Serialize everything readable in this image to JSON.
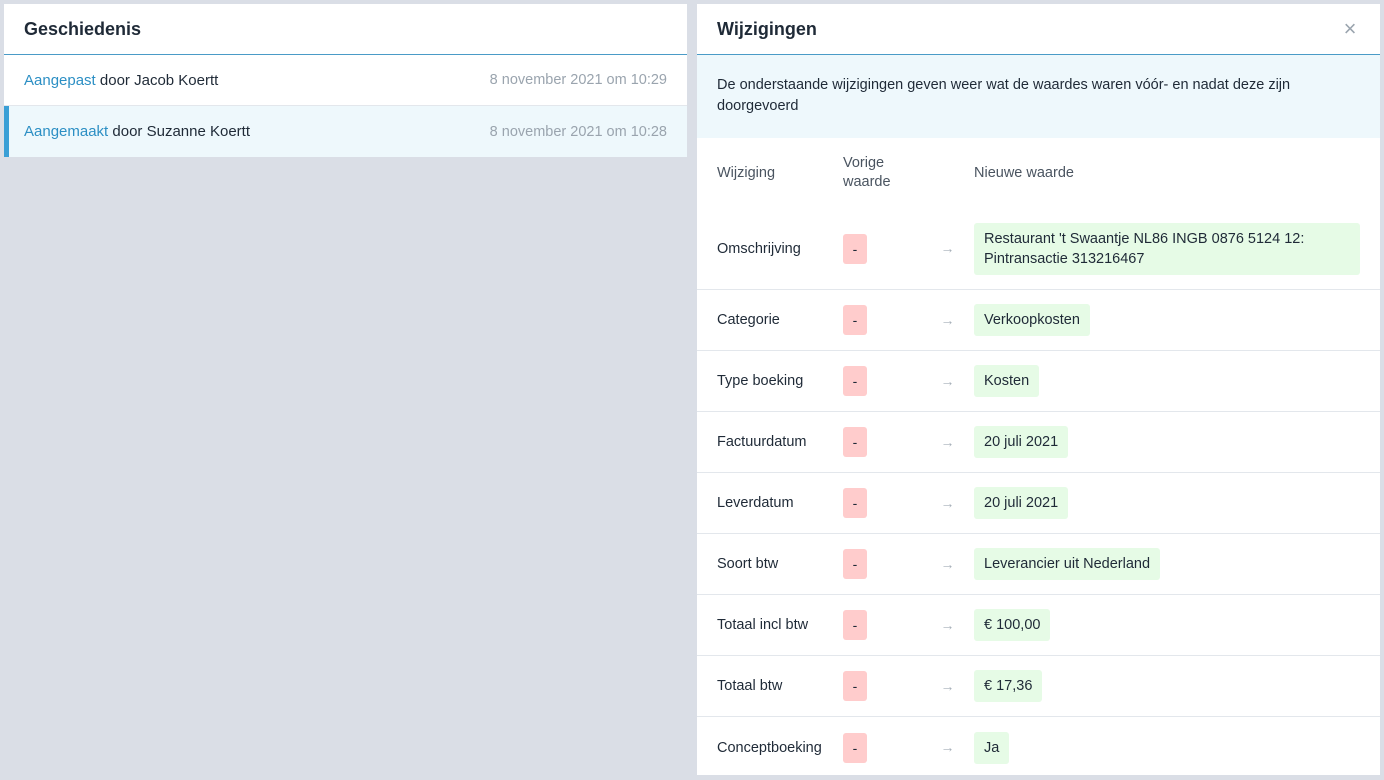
{
  "history": {
    "title": "Geschiedenis",
    "items": [
      {
        "action": "Aangepast",
        "by": "door Jacob Koertt",
        "date": "8 november 2021 om 10:29"
      },
      {
        "action": "Aangemaakt",
        "by": "door Suzanne Koertt",
        "date": "8 november 2021 om 10:28"
      }
    ]
  },
  "changes": {
    "title": "Wijzigingen",
    "close_icon": "×",
    "info": "De onderstaande wijzigingen geven weer wat de waardes waren vóór- en nadat deze zijn doorgevoerd",
    "columns": {
      "label": "Wijziging",
      "old": "Vorige waarde",
      "new": "Nieuwe waarde"
    },
    "arrow": "→",
    "rows": [
      {
        "label": "Omschrijving",
        "old": "-",
        "new": "Restaurant 't Swaantje NL86 INGB 0876 5124 12: Pintransactie 313216467"
      },
      {
        "label": "Categorie",
        "old": "-",
        "new": "Verkoopkosten"
      },
      {
        "label": "Type boeking",
        "old": "-",
        "new": "Kosten"
      },
      {
        "label": "Factuurdatum",
        "old": "-",
        "new": "20 juli 2021"
      },
      {
        "label": "Leverdatum",
        "old": "-",
        "new": "20 juli 2021"
      },
      {
        "label": "Soort btw",
        "old": "-",
        "new": "Leverancier uit Nederland"
      },
      {
        "label": "Totaal incl btw",
        "old": "-",
        "new": "€ 100,00"
      },
      {
        "label": "Totaal btw",
        "old": "-",
        "new": "€ 17,36"
      },
      {
        "label": "Conceptboeking",
        "old": "-",
        "new": "Ja"
      }
    ]
  },
  "colors": {
    "accent": "#3a9fd6",
    "old_value_bg": "#ffcccc",
    "new_value_bg": "#e6fbe6",
    "info_bg": "#eef8fc"
  }
}
